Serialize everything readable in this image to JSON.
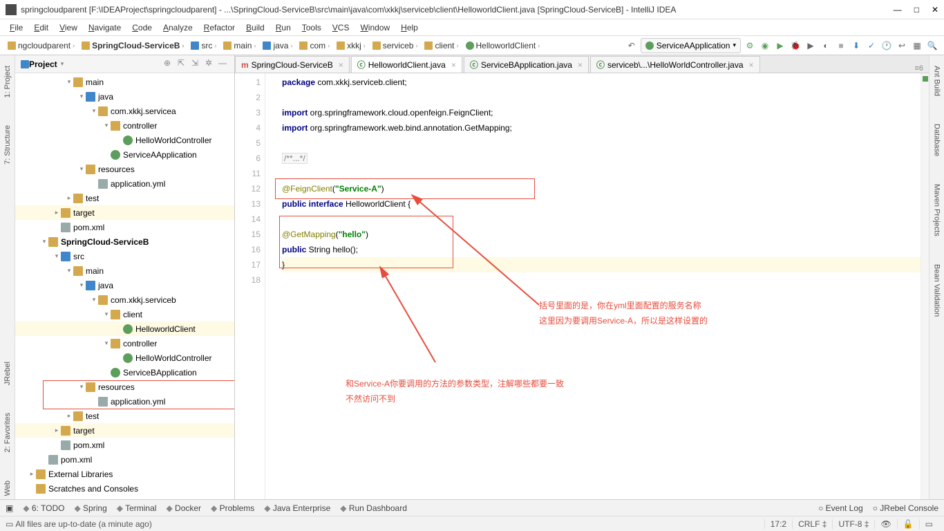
{
  "window": {
    "title": "springcloudparent [F:\\IDEAProject\\springcloudparent] - ...\\SpringCloud-ServiceB\\src\\main\\java\\com\\xkkj\\serviceb\\client\\HelloworldClient.java [SpringCloud-ServiceB] - IntelliJ IDEA"
  },
  "menu": [
    "File",
    "Edit",
    "View",
    "Navigate",
    "Code",
    "Analyze",
    "Refactor",
    "Build",
    "Run",
    "Tools",
    "VCS",
    "Window",
    "Help"
  ],
  "breadcrumbs": [
    "ngcloudparent",
    "SpringCloud-ServiceB",
    "src",
    "main",
    "java",
    "com",
    "xkkj",
    "serviceb",
    "client",
    "HelloworldClient"
  ],
  "runConfig": "ServiceAApplication",
  "leftTabs": [
    "7: Structure",
    "1: Project"
  ],
  "leftTabs2": [
    "Web",
    "2: Favorites",
    "JRebel"
  ],
  "rightTabs": [
    "Ant Build",
    "Database",
    "Maven Projects",
    "Bean Validation"
  ],
  "project": {
    "title": "Project",
    "tree": [
      {
        "d": 4,
        "exp": "▾",
        "ico": "folder",
        "label": "main"
      },
      {
        "d": 5,
        "exp": "▾",
        "ico": "blue",
        "label": "java"
      },
      {
        "d": 6,
        "exp": "▾",
        "ico": "folder",
        "label": "com.xkkj.servicea"
      },
      {
        "d": 7,
        "exp": "▾",
        "ico": "folder",
        "label": "controller"
      },
      {
        "d": 8,
        "exp": "",
        "ico": "class",
        "label": "HelloWorldController"
      },
      {
        "d": 7,
        "exp": "",
        "ico": "class",
        "label": "ServiceAApplication"
      },
      {
        "d": 5,
        "exp": "▾",
        "ico": "folder",
        "label": "resources"
      },
      {
        "d": 6,
        "exp": "",
        "ico": "file",
        "label": "application.yml"
      },
      {
        "d": 4,
        "exp": "▸",
        "ico": "folder",
        "label": "test"
      },
      {
        "d": 3,
        "exp": "▸",
        "ico": "folder",
        "label": "target",
        "sel": true
      },
      {
        "d": 3,
        "exp": "",
        "ico": "file",
        "label": "pom.xml"
      },
      {
        "d": 2,
        "exp": "▾",
        "ico": "folder",
        "label": "SpringCloud-ServiceB",
        "bold": true
      },
      {
        "d": 3,
        "exp": "▾",
        "ico": "blue",
        "label": "src"
      },
      {
        "d": 4,
        "exp": "▾",
        "ico": "folder",
        "label": "main"
      },
      {
        "d": 5,
        "exp": "▾",
        "ico": "blue",
        "label": "java"
      },
      {
        "d": 6,
        "exp": "▾",
        "ico": "folder",
        "label": "com.xkkj.serviceb"
      },
      {
        "d": 7,
        "exp": "▾",
        "ico": "folder",
        "label": "client",
        "box": true
      },
      {
        "d": 8,
        "exp": "",
        "ico": "class",
        "label": "HelloworldClient",
        "box": true,
        "sel": true
      },
      {
        "d": 7,
        "exp": "▾",
        "ico": "folder",
        "label": "controller"
      },
      {
        "d": 8,
        "exp": "",
        "ico": "class",
        "label": "HelloWorldController"
      },
      {
        "d": 7,
        "exp": "",
        "ico": "class",
        "label": "ServiceBApplication"
      },
      {
        "d": 5,
        "exp": "▾",
        "ico": "folder",
        "label": "resources"
      },
      {
        "d": 6,
        "exp": "",
        "ico": "file",
        "label": "application.yml"
      },
      {
        "d": 4,
        "exp": "▸",
        "ico": "folder",
        "label": "test"
      },
      {
        "d": 3,
        "exp": "▸",
        "ico": "folder",
        "label": "target",
        "sel": true
      },
      {
        "d": 3,
        "exp": "",
        "ico": "file",
        "label": "pom.xml"
      },
      {
        "d": 2,
        "exp": "",
        "ico": "file",
        "label": "pom.xml"
      },
      {
        "d": 1,
        "exp": "▸",
        "ico": "folder",
        "label": "External Libraries"
      },
      {
        "d": 1,
        "exp": "",
        "ico": "folder",
        "label": "Scratches and Consoles"
      }
    ]
  },
  "tabsOpen": [
    {
      "label": "SpringCloud-ServiceB",
      "ico": "m"
    },
    {
      "label": "HelloworldClient.java",
      "ico": "c",
      "active": true
    },
    {
      "label": "ServiceBApplication.java",
      "ico": "c"
    },
    {
      "label": "serviceb\\...\\HelloWorldController.java",
      "ico": "c"
    }
  ],
  "tabsRight": "≡6",
  "codeLines": [
    {
      "n": 1,
      "html": "<span class='kw'>package</span> com.xkkj.serviceb.client;"
    },
    {
      "n": 2,
      "html": ""
    },
    {
      "n": 3,
      "html": "<span class='kw'>import</span> org.springframework.cloud.openfeign.FeignClient;"
    },
    {
      "n": 4,
      "html": "<span class='kw'>import</span> org.springframework.web.bind.annotation.GetMapping;"
    },
    {
      "n": 5,
      "html": ""
    },
    {
      "n": 6,
      "html": "<span class='cmt'>/**...*/</span>"
    },
    {
      "n": 11,
      "html": ""
    },
    {
      "n": 12,
      "html": "<span class='ann'>@FeignClient</span>(<span class='str'>\"Service-A\"</span>)"
    },
    {
      "n": 13,
      "html": "<span class='kw'>public interface</span> <span class='cls'>HelloworldClient</span> {"
    },
    {
      "n": 14,
      "html": ""
    },
    {
      "n": 15,
      "html": "    <span class='ann'>@GetMapping</span>(<span class='str'>\"hello\"</span>)"
    },
    {
      "n": 16,
      "html": "    <span class='kw'>public</span> String hello();"
    },
    {
      "n": 17,
      "html": "<span class='hl-line'>}</span>"
    },
    {
      "n": 18,
      "html": ""
    }
  ],
  "annotations": {
    "right1": "括号里面的是，你在yml里面配置的服务名称",
    "right2": "这里因为要调用Service-A，所以是这样设置的",
    "bottom1": "和Service-A你要调用的方法的参数类型，注解哪些都要一致",
    "bottom2": "不然访问不到"
  },
  "bottomTools": [
    "6: TODO",
    "Spring",
    "Terminal",
    "Docker",
    "Problems",
    "Java Enterprise",
    "Run Dashboard"
  ],
  "bottomRight": [
    "Event Log",
    "JRebel Console"
  ],
  "status": {
    "msg": "All files are up-to-date (a minute ago)",
    "pos": "17:2",
    "sep": "CRLF",
    "enc": "UTF-8"
  }
}
